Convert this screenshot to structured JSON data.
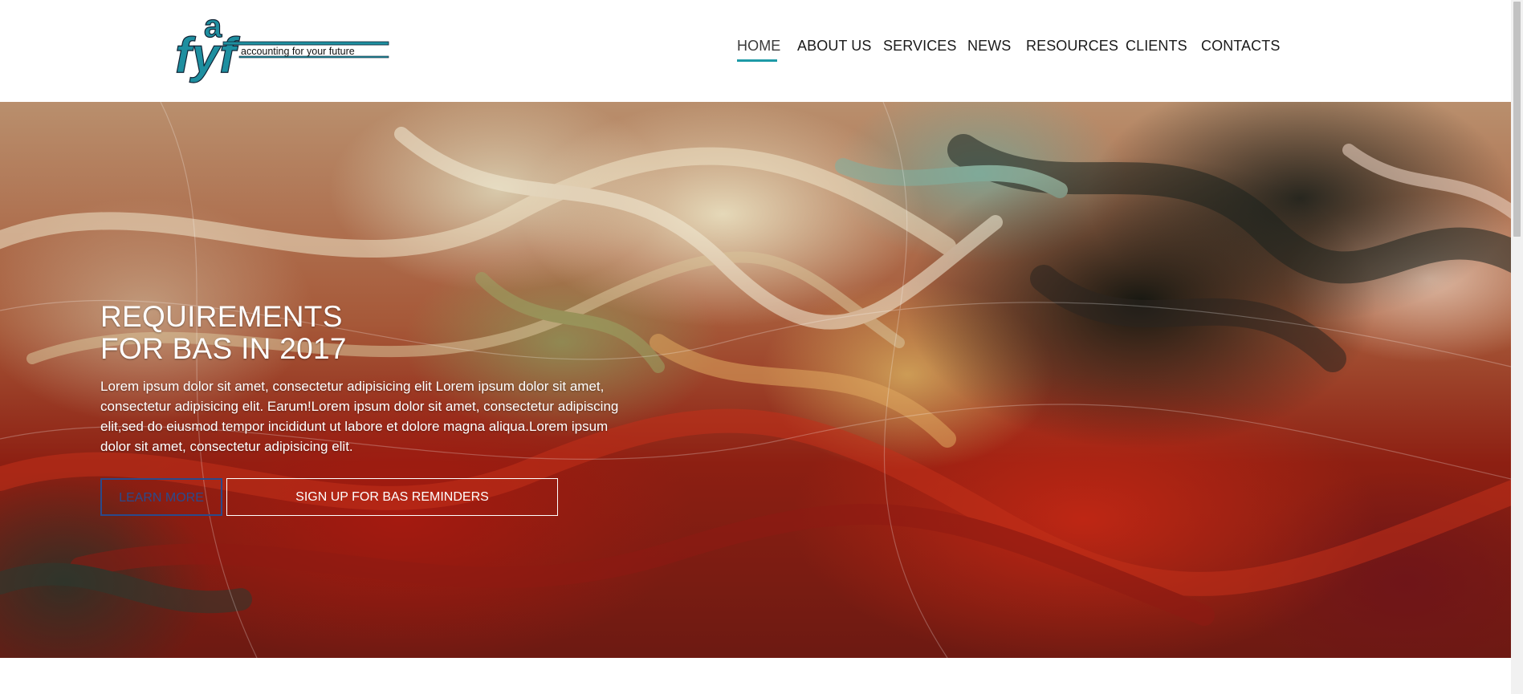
{
  "logo": {
    "letters_top": "a",
    "letters_main": "fyf",
    "tagline": "accounting for your future",
    "color": "#1e8fa0"
  },
  "nav": {
    "items": [
      {
        "label": "HOME",
        "active": true
      },
      {
        "label": "ABOUT US",
        "active": false
      },
      {
        "label": "SERVICES",
        "active": false
      },
      {
        "label": "NEWS",
        "active": false
      },
      {
        "label": "RESOURCES",
        "active": false
      },
      {
        "label": "CLIENTS",
        "active": false
      },
      {
        "label": "CONTACTS",
        "active": false
      }
    ],
    "accent": "#1e9aa7"
  },
  "hero": {
    "title_line1": "REQUIREMENTS",
    "title_line2": "FOR BAS IN 2017",
    "body": "Lorem ipsum dolor sit amet, consectetur adipisicing elit Lorem ipsum dolor sit amet, consectetur adipisicing elit. Earum!Lorem ipsum dolor sit amet, consectetur adipiscing elit,sed do eiusmod tempor incididunt ut labore et dolore magna aliqua.Lorem ipsum dolor sit amet, consectetur adipisicing elit.",
    "learn_more_label": "LEARN MORE",
    "signup_label": "SIGN UP FOR BAS REMINDERS"
  }
}
